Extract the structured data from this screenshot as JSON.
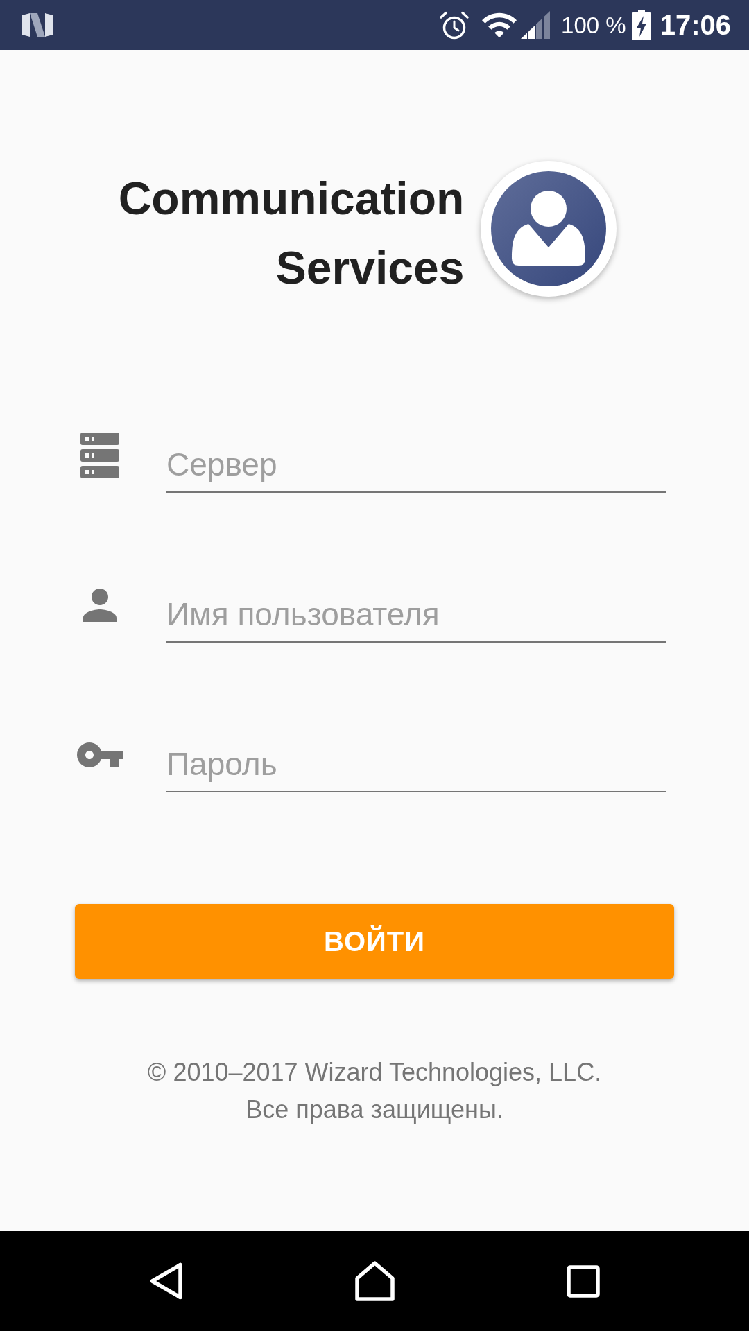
{
  "status_bar": {
    "battery_text": "100 %",
    "time": "17:06"
  },
  "header": {
    "title_lines": [
      "Communication",
      "Services"
    ]
  },
  "fields": [
    {
      "kind": "server",
      "placeholder": "Сервер"
    },
    {
      "kind": "user",
      "placeholder": "Имя пользователя"
    },
    {
      "kind": "password",
      "placeholder": "Пароль"
    }
  ],
  "login_button": {
    "label": "ВОЙТИ"
  },
  "footer": {
    "lines": [
      "© 2010–2017 Wizard Technologies, LLC.",
      "Все права защищены."
    ]
  }
}
